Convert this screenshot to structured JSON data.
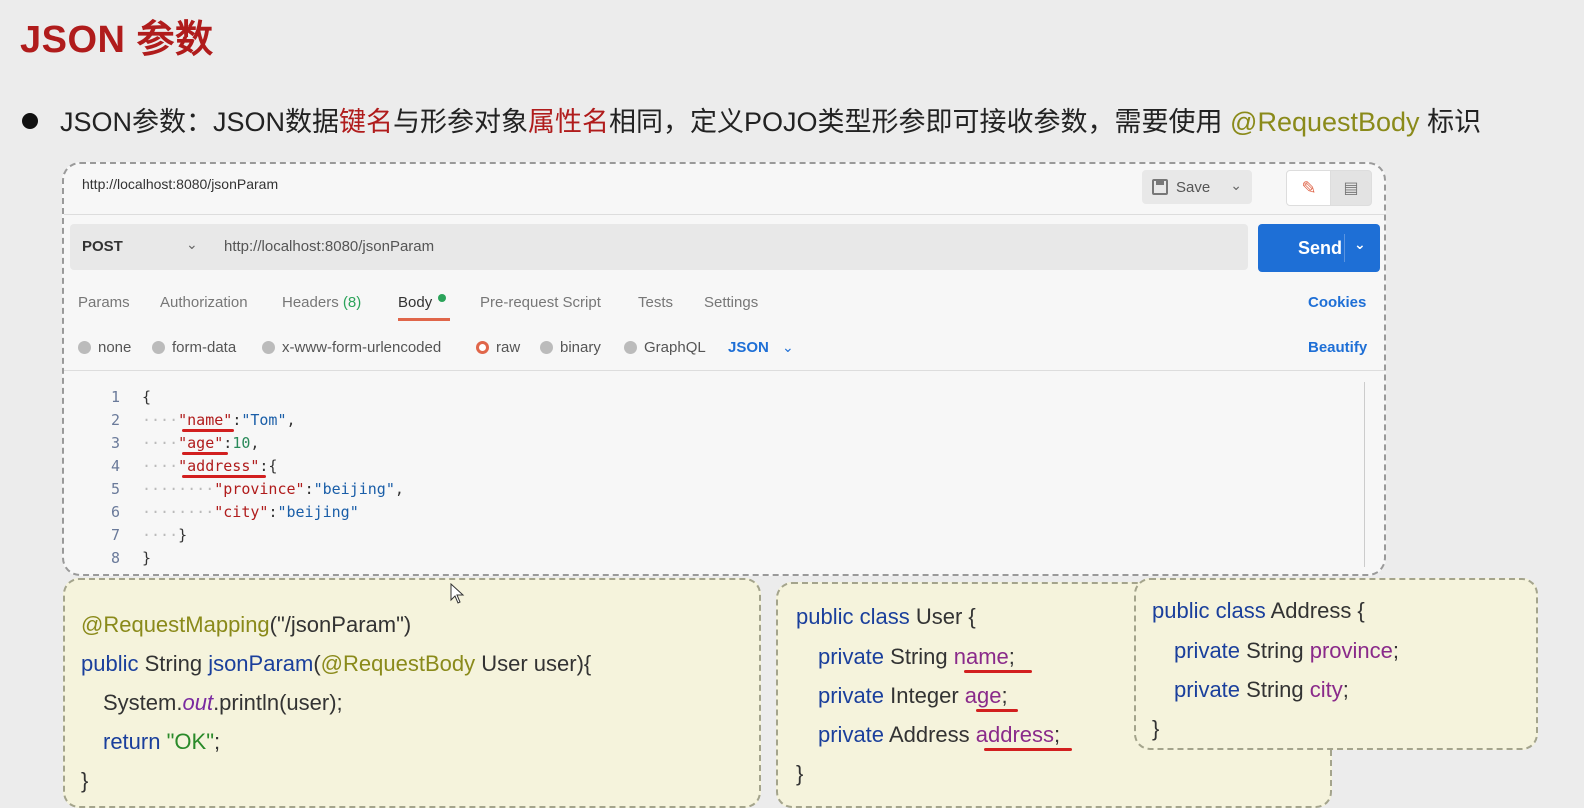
{
  "slide": {
    "title": "JSON 参数",
    "bullet": {
      "p1": "JSON参数：JSON数据",
      "p2": "键名",
      "p3": "与形参对象",
      "p4": "属性名",
      "p5": "相同，定义POJO类型形参即可接收参数，需要使用 ",
      "p6": "@RequestBody",
      "p7": " 标识"
    }
  },
  "postman": {
    "tab_url": "http://localhost:8080/jsonParam",
    "save_label": "Save",
    "method": "POST",
    "url": "http://localhost:8080/jsonParam",
    "send_label": "Send",
    "tabs": {
      "params": "Params",
      "authorization": "Authorization",
      "headers": "Headers",
      "headers_count": "(8)",
      "body": "Body",
      "prerequest": "Pre-request Script",
      "tests": "Tests",
      "settings": "Settings"
    },
    "cookies_label": "Cookies",
    "body_types": {
      "none": "none",
      "form_data": "form-data",
      "urlencoded": "x-www-form-urlencoded",
      "raw": "raw",
      "binary": "binary",
      "graphql": "GraphQL"
    },
    "selected_body_type": "raw",
    "json_type_label": "JSON",
    "beautify_label": "Beautify",
    "line_numbers": [
      "1",
      "2",
      "3",
      "4",
      "5",
      "6",
      "7",
      "8"
    ],
    "code": {
      "l1": "{",
      "k_name": "\"name\"",
      "v_name": "\"Tom\"",
      "k_age": "\"age\"",
      "v_age": "10",
      "k_address": "\"address\"",
      "k_province": "\"province\"",
      "v_province": "\"beijing\"",
      "k_city": "\"city\"",
      "v_city": "\"beijing\"",
      "l7": "}",
      "l8": "}"
    }
  },
  "controller_card": {
    "l1_ann": "@RequestMapping",
    "l1_rest": "(\"/jsonParam\")",
    "l2_kw": "public",
    "l2_type": " String ",
    "l2_fn": "jsonParam",
    "l2_open": "(",
    "l2_ann": "@RequestBody",
    "l2_rest": " User user){",
    "l3_a": "System.",
    "l3_out": "out",
    "l3_b": ".println(user);",
    "l4_kw": "return",
    "l4_str": " \"OK\"",
    "l4_end": ";",
    "l5": "}"
  },
  "user_card": {
    "l1_kw": "public class",
    "l1_rest": " User {",
    "l2_kw": "private",
    "l2_type": " String ",
    "l2_prop": "name",
    "l2_end": ";",
    "l3_kw": "private",
    "l3_type": " Integer ",
    "l3_prop": "age",
    "l3_end": ";",
    "l4_kw": "private",
    "l4_type": " Address ",
    "l4_prop": "address",
    "l4_end": ";",
    "l5": "}"
  },
  "address_card": {
    "l1_kw": "public class",
    "l1_rest": " Address {",
    "l2_kw": "private",
    "l2_type": " String ",
    "l2_prop": "province",
    "l2_end": ";",
    "l3_kw": "private",
    "l3_type": " String ",
    "l3_prop": "city",
    "l3_end": ";",
    "l4": "}"
  },
  "colors": {
    "title_red": "#b01c1c",
    "annotation_olive": "#8a8a1a",
    "send_blue": "#1e6fd6",
    "active_orange": "#e0664a",
    "underline_red": "#d21f1f"
  }
}
